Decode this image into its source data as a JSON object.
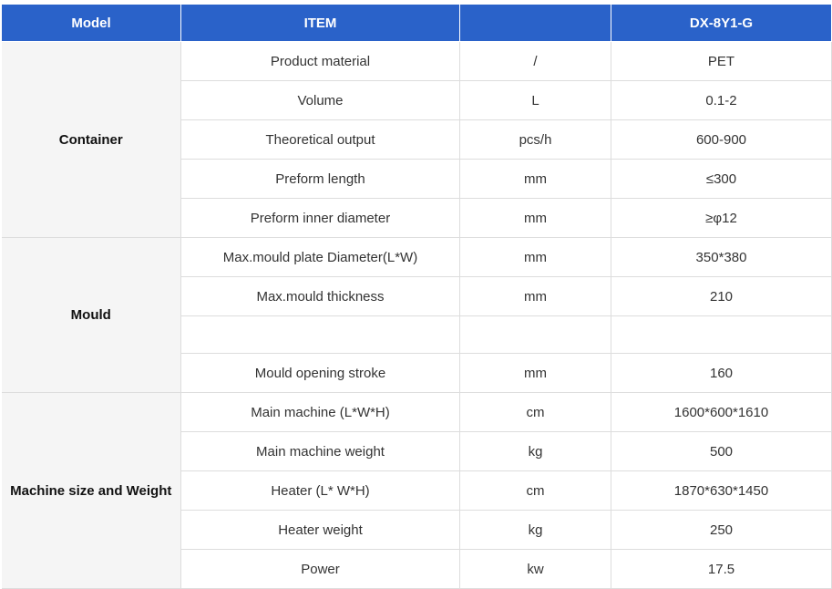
{
  "header": {
    "model": "Model",
    "item": "ITEM",
    "unit": "",
    "value": "DX-8Y1-G"
  },
  "groups": [
    {
      "name": "Container",
      "rows": [
        {
          "item": "Product material",
          "unit": "/",
          "value": "PET"
        },
        {
          "item": "Volume",
          "unit": "L",
          "value": "0.1-2"
        },
        {
          "item": "Theoretical output",
          "unit": "pcs/h",
          "value": "600-900"
        },
        {
          "item": "Preform length",
          "unit": "mm",
          "value": "≤300"
        },
        {
          "item": "Preform inner diameter",
          "unit": "mm",
          "value": "≥φ12"
        }
      ]
    },
    {
      "name": "Mould",
      "rows": [
        {
          "item": "Max.mould plate Diameter(L*W)",
          "unit": "mm",
          "value": "350*380"
        },
        {
          "item": "Max.mould thickness",
          "unit": "mm",
          "value": "210"
        },
        {
          "item": "",
          "unit": "",
          "value": ""
        },
        {
          "item": "Mould opening stroke",
          "unit": "mm",
          "value": "160"
        }
      ]
    },
    {
      "name": "Machine size and Weight",
      "rows": [
        {
          "item": "Main machine (L*W*H)",
          "unit": "cm",
          "value": "1600*600*1610"
        },
        {
          "item": "Main machine weight",
          "unit": "kg",
          "value": "500"
        },
        {
          "item": "Heater (L* W*H)",
          "unit": "cm",
          "value": "1870*630*1450"
        },
        {
          "item": "Heater weight",
          "unit": "kg",
          "value": "250"
        },
        {
          "item": "Power",
          "unit": "kw",
          "value": "17.5"
        }
      ]
    }
  ]
}
